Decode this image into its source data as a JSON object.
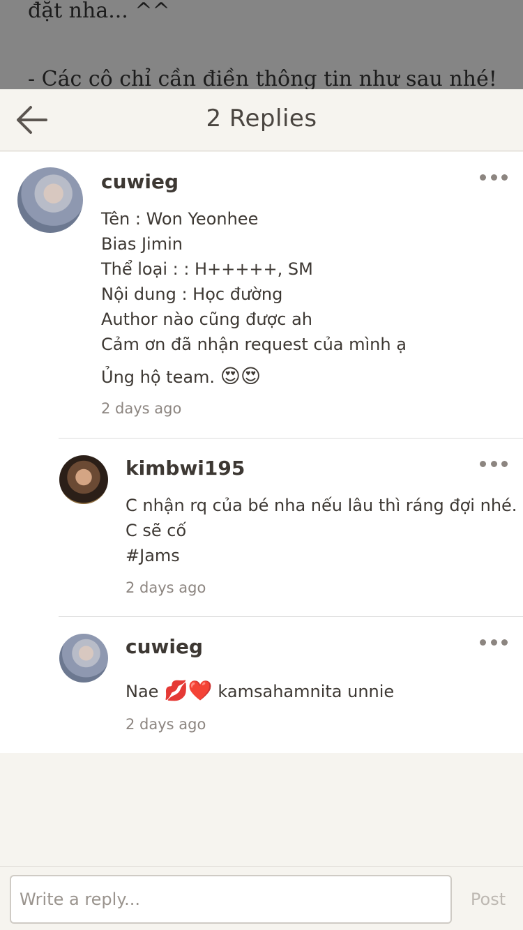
{
  "background_story": {
    "line1": "đặt nha... ^^",
    "line2": "- Các cô chỉ cần điền thông tin như sau nhé!"
  },
  "header": {
    "back_icon": "arrow-left-icon",
    "title": "2 Replies"
  },
  "replies": [
    {
      "username": "cuwieg",
      "lines": [
        "Tên : Won Yeonhee",
        "Bias Jimin",
        "Thể loại : : H+++++, SM",
        "Nội dung : Học đường",
        "Author nào cũng được ah",
        "Cảm ơn đã nhận request của mình ạ"
      ],
      "last_line_text": "Ủng hộ team. ",
      "last_line_emoji": "😍😍",
      "timestamp": "2 days ago"
    },
    {
      "username": "kimbwi195",
      "lines": [
        "C nhận rq của bé nha nếu lâu thì ráng đợi nhé.",
        "C sẽ cố",
        "#Jams"
      ],
      "timestamp": "2 days ago"
    },
    {
      "username": "cuwieg",
      "line_start": "Nae ",
      "line_emoji": "💋❤️",
      "line_end": " kamsahamnita unnie",
      "timestamp": "2 days ago"
    }
  ],
  "composer": {
    "placeholder": "Write a reply...",
    "post_label": "Post"
  },
  "colors": {
    "background": "#f6f4ef",
    "card": "#ffffff",
    "text": "#3d3833",
    "muted": "#8c8580",
    "post_disabled": "#bdb8b2"
  }
}
